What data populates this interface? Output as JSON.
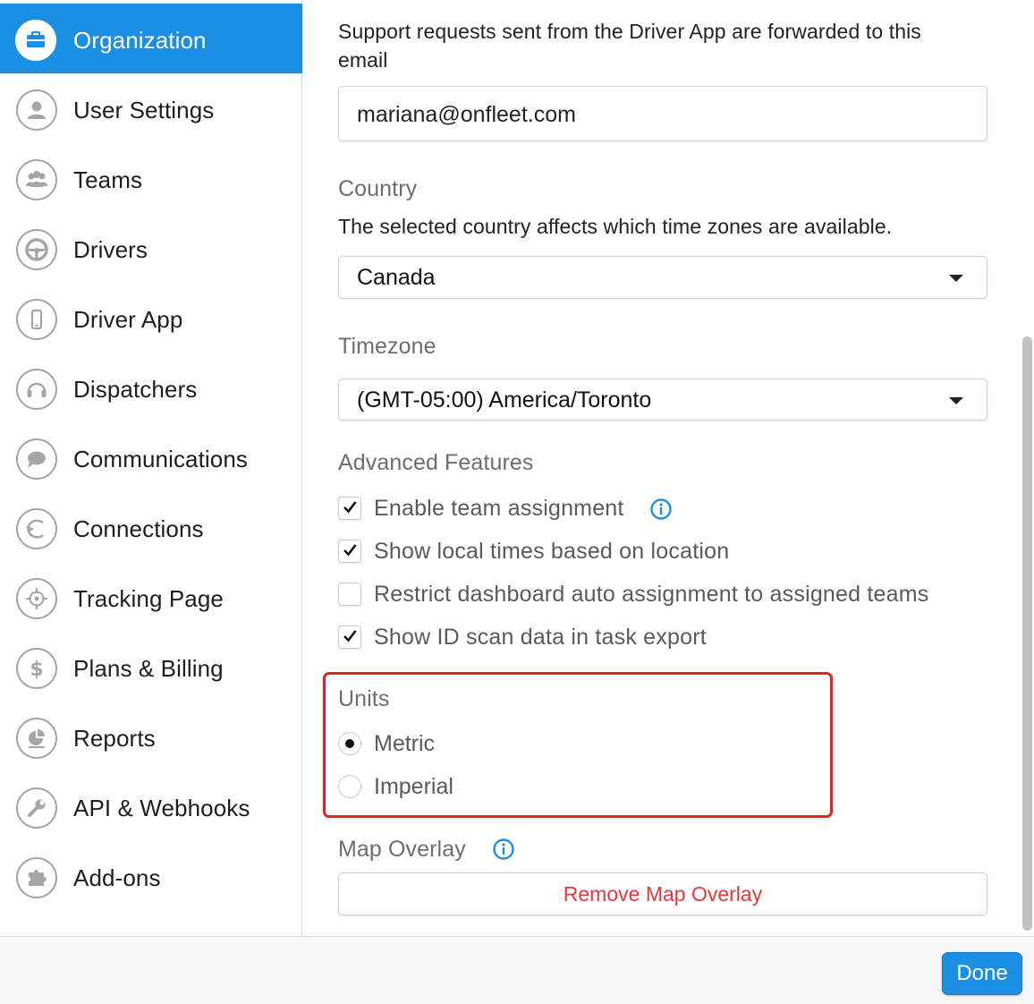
{
  "sidebar": {
    "items": [
      {
        "label": "Organization",
        "icon": "briefcase-icon",
        "active": true
      },
      {
        "label": "User Settings",
        "icon": "user-icon"
      },
      {
        "label": "Teams",
        "icon": "team-icon"
      },
      {
        "label": "Drivers",
        "icon": "steering-wheel-icon"
      },
      {
        "label": "Driver App",
        "icon": "phone-icon"
      },
      {
        "label": "Dispatchers",
        "icon": "headset-icon"
      },
      {
        "label": "Communications",
        "icon": "chat-bubble-icon"
      },
      {
        "label": "Connections",
        "icon": "connections-icon"
      },
      {
        "label": "Tracking Page",
        "icon": "crosshair-icon"
      },
      {
        "label": "Plans & Billing",
        "icon": "dollar-icon"
      },
      {
        "label": "Reports",
        "icon": "pie-chart-icon"
      },
      {
        "label": "API & Webhooks",
        "icon": "wrench-icon"
      },
      {
        "label": "Add-ons",
        "icon": "puzzle-icon"
      }
    ]
  },
  "main": {
    "support_desc": "Support requests sent from the Driver App are forwarded to this email",
    "support_desc_line1": "Support requests sent from the Driver App are forwarded to this",
    "support_desc_line2": "email",
    "support_email": "mariana@onfleet.com",
    "country_heading": "Country",
    "country_desc": "The selected country affects which time zones are available.",
    "country_value": "Canada",
    "timezone_heading": "Timezone",
    "timezone_value": "(GMT-05:00) America/Toronto",
    "advanced_heading": "Advanced Features",
    "features": [
      {
        "label": "Enable team assignment",
        "checked": true,
        "info": true
      },
      {
        "label": "Show local times based on location",
        "checked": true
      },
      {
        "label": "Restrict dashboard auto assignment to assigned teams",
        "checked": false
      },
      {
        "label": "Show ID scan data in task export",
        "checked": true
      }
    ],
    "units_heading": "Units",
    "units_options": [
      {
        "label": "Metric",
        "selected": true
      },
      {
        "label": "Imperial",
        "selected": false
      }
    ],
    "map_overlay_heading": "Map Overlay",
    "remove_overlay_label": "Remove Map Overlay"
  },
  "footer": {
    "done_label": "Done"
  },
  "colors": {
    "accent": "#1b8fe3",
    "highlight_box": "#e0232a",
    "danger_text": "#e8363b",
    "info_icon": "#1b8fe3"
  }
}
